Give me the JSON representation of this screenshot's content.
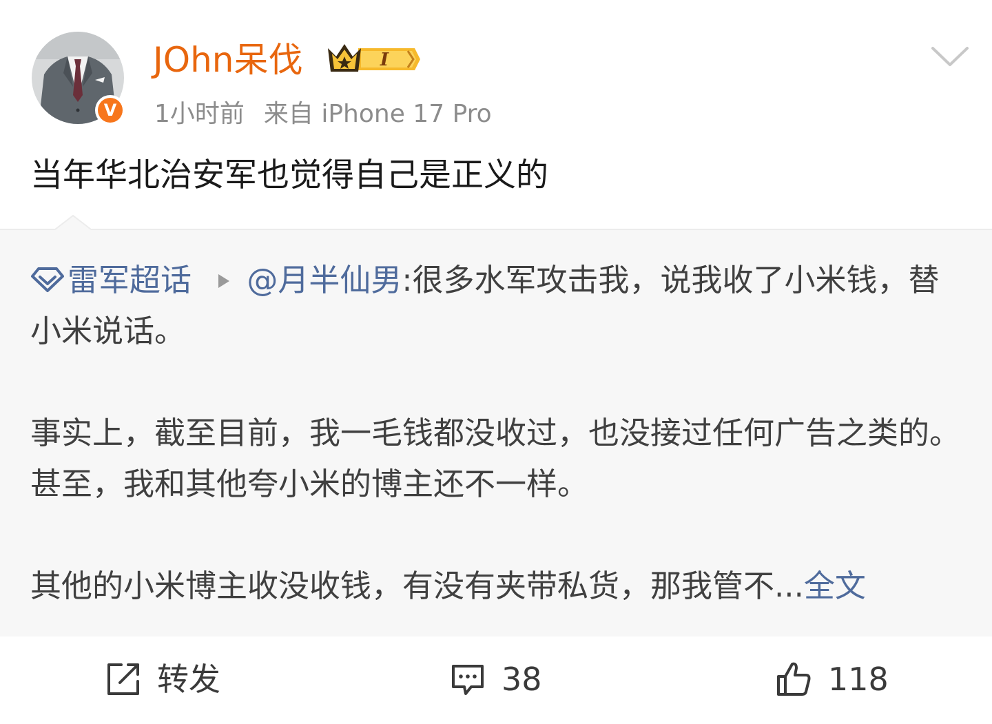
{
  "post": {
    "author": {
      "name": "JOhn呆伐",
      "avatar_icon": "avatar-man-in-suit",
      "verified_icon": "verified-v-badge",
      "verified_letter": "V",
      "vip_icon": "crown-level-badge",
      "vip_level": "I"
    },
    "time": "1小时前",
    "source": "来自 iPhone 17 Pro",
    "text": "当年华北治安军也觉得自己是正义的"
  },
  "quote": {
    "topic": "雷军超话",
    "mention": "@月半仙男",
    "line1_text": ":很多水军攻击我，说我收了小米钱，替小米说话。",
    "paragraph2": "事实上，截至目前，我一毛钱都没收过，也没接过任何广告之类的。甚至，我和其他夸小米的博主还不一样。",
    "paragraph3": "其他的小米博主收没收钱，有没有夹带私货，那我管不...",
    "full_text_link": "全文"
  },
  "actions": {
    "retweet_label": "转发",
    "comment_count": "38",
    "like_count": "118"
  },
  "colors": {
    "username": "#e8660e",
    "link": "#4f6b9c",
    "meta": "#8c8c8c",
    "quote_bg": "#f7f7f7",
    "verified_badge": "#f7761c"
  }
}
